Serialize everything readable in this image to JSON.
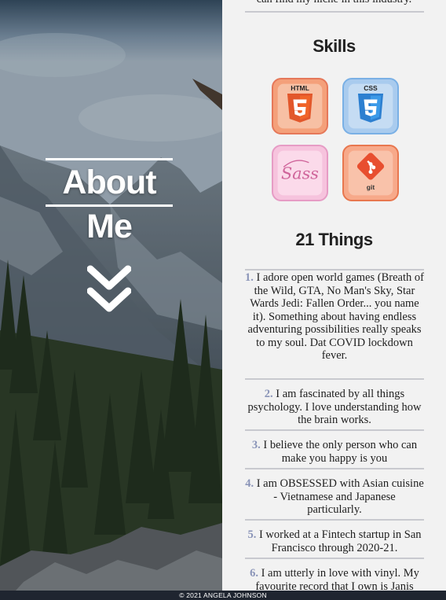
{
  "hero": {
    "title": "About Me"
  },
  "panel": {
    "intro_tail": "can find my niche in this industry.",
    "skills_heading": "Skills",
    "skills": [
      {
        "name": "html5-icon",
        "label": "HTML"
      },
      {
        "name": "css3-icon",
        "label": "CSS"
      },
      {
        "name": "sass-icon",
        "label": "Sass"
      },
      {
        "name": "git-icon",
        "label": "git"
      }
    ],
    "things_heading": "21 Things",
    "things": [
      {
        "num": "1.",
        "text": " I adore open world games (Breath of the Wild, GTA, No Man's Sky, Star Wards Jedi: Fallen Order... you name it). Something about having endless adventuring possibilities really speaks to my soul. Dat COVID lockdown fever."
      },
      {
        "num": "2.",
        "text": " I am fascinated by all things psychology. I love understanding how the brain works."
      },
      {
        "num": "3.",
        "text": " I believe the only person who can make you happy is you"
      },
      {
        "num": "4.",
        "text": " I am OBSESSED with Asian cuisine - Vietnamese and Japanese particularly."
      },
      {
        "num": "5.",
        "text": " I worked at a Fintech startup in San Francisco through 2020-21."
      },
      {
        "num": "6.",
        "text": " I am utterly in love with vinyl. My favourite record that I own is Janis Joplin's 'Pearl'"
      }
    ]
  },
  "footer": {
    "text": "© 2021 ANGELA JOHNSON"
  },
  "colors": {
    "number_accent": "#8a94b8",
    "footer_bg": "#1f2530",
    "html_orange": "#e2572b",
    "css_blue": "#2c7fd0",
    "sass_pink": "#cf649a",
    "git_orange": "#e84e2f"
  }
}
